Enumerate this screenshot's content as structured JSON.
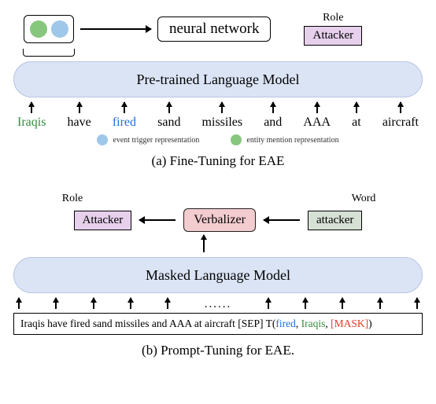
{
  "figA": {
    "nn_label": "neural network",
    "role_header": "Role",
    "role_value": "Attacker",
    "plm_label": "Pre-trained Language Model",
    "tokens": [
      "Iraqis",
      "have",
      "fired",
      "sand",
      "missiles",
      "and",
      "AAA",
      "at",
      "aircraft"
    ],
    "token_classes": [
      "tok-green",
      "",
      "tok-blue",
      "",
      "",
      "",
      "",
      "",
      ""
    ],
    "legend": {
      "trigger": "event trigger representation",
      "mention": "entity mention representation"
    },
    "caption": "(a) Fine-Tuning for EAE"
  },
  "figB": {
    "role_header": "Role",
    "role_value": "Attacker",
    "verbalizer": "Verbalizer",
    "word_header": "Word",
    "word_value": "attacker",
    "mlm_label": "Masked Language Model",
    "dots": "......",
    "sentence": {
      "pre": "Iraqis have fired sand missiles and AAA at aircraft [SEP] T(",
      "trigger": "fired",
      "sep1": ", ",
      "entity": "Iraqis",
      "sep2": ", ",
      "mask": "[MASK]",
      "post": ")"
    },
    "caption": "(b) Prompt-Tuning for EAE."
  }
}
